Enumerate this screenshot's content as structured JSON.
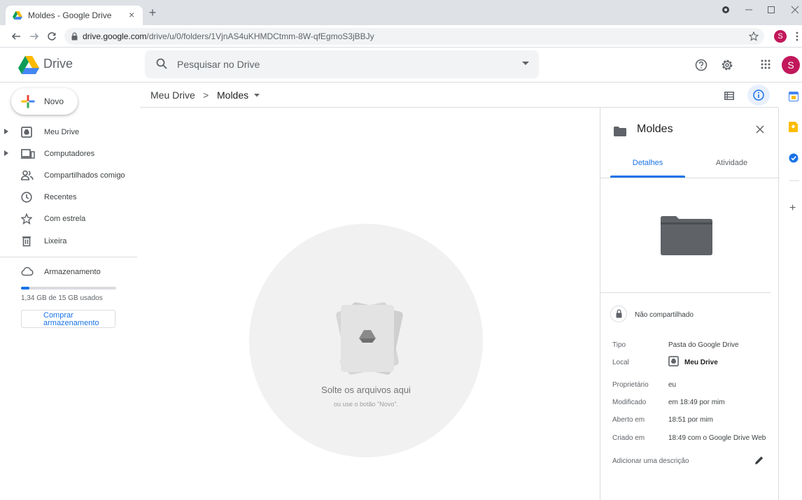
{
  "browser": {
    "tab_title": "Moldes - Google Drive",
    "tab_close": "×",
    "new_tab": "+",
    "url_host": "drive.google.com",
    "url_path": "/drive/u/0/folders/1VjnAS4uKHMDCtmm-8W-qfEgmoS3jBBJy",
    "profile_initial": "S"
  },
  "header": {
    "brand": "Drive",
    "search_placeholder": "Pesquisar no Drive",
    "avatar_initial": "S"
  },
  "sidebar": {
    "new_label": "Novo",
    "items": [
      {
        "label": "Meu Drive",
        "icon": "drive-icon"
      },
      {
        "label": "Computadores",
        "icon": "computers-icon"
      },
      {
        "label": "Compartilhados comigo",
        "icon": "shared-icon"
      },
      {
        "label": "Recentes",
        "icon": "clock-icon"
      },
      {
        "label": "Com estrela",
        "icon": "star-icon"
      },
      {
        "label": "Lixeira",
        "icon": "trash-icon"
      }
    ],
    "storage_label": "Armazenamento",
    "storage_used": "1,34 GB de 15 GB usados",
    "storage_fraction": 0.089,
    "buy_storage": "Comprar armazenamento"
  },
  "breadcrumb": {
    "root": "Meu Drive",
    "separator": ">",
    "current": "Moldes"
  },
  "dropzone": {
    "title": "Solte os arquivos aqui",
    "subtitle": "ou use o botão \"Novo\"."
  },
  "details": {
    "title": "Moldes",
    "tab_details": "Detalhes",
    "tab_activity": "Atividade",
    "sharing": "Não compartilhado",
    "rows": [
      {
        "key": "Tipo",
        "value": "Pasta do Google Drive"
      },
      {
        "key": "Local",
        "value": "Meu Drive"
      },
      {
        "key": "Proprietário",
        "value": "eu"
      },
      {
        "key": "Modificado",
        "value": "em 18:49 por mim"
      },
      {
        "key": "Aberto em",
        "value": "18:51 por mim"
      },
      {
        "key": "Criado em",
        "value": "18:49 com o Google Drive Web"
      }
    ],
    "add_description": "Adicionar uma descrição"
  },
  "rail": {
    "add": "+"
  },
  "colors": {
    "accent": "#1a73e8",
    "avatar": "#c2185b",
    "folder": "#5f6368"
  }
}
